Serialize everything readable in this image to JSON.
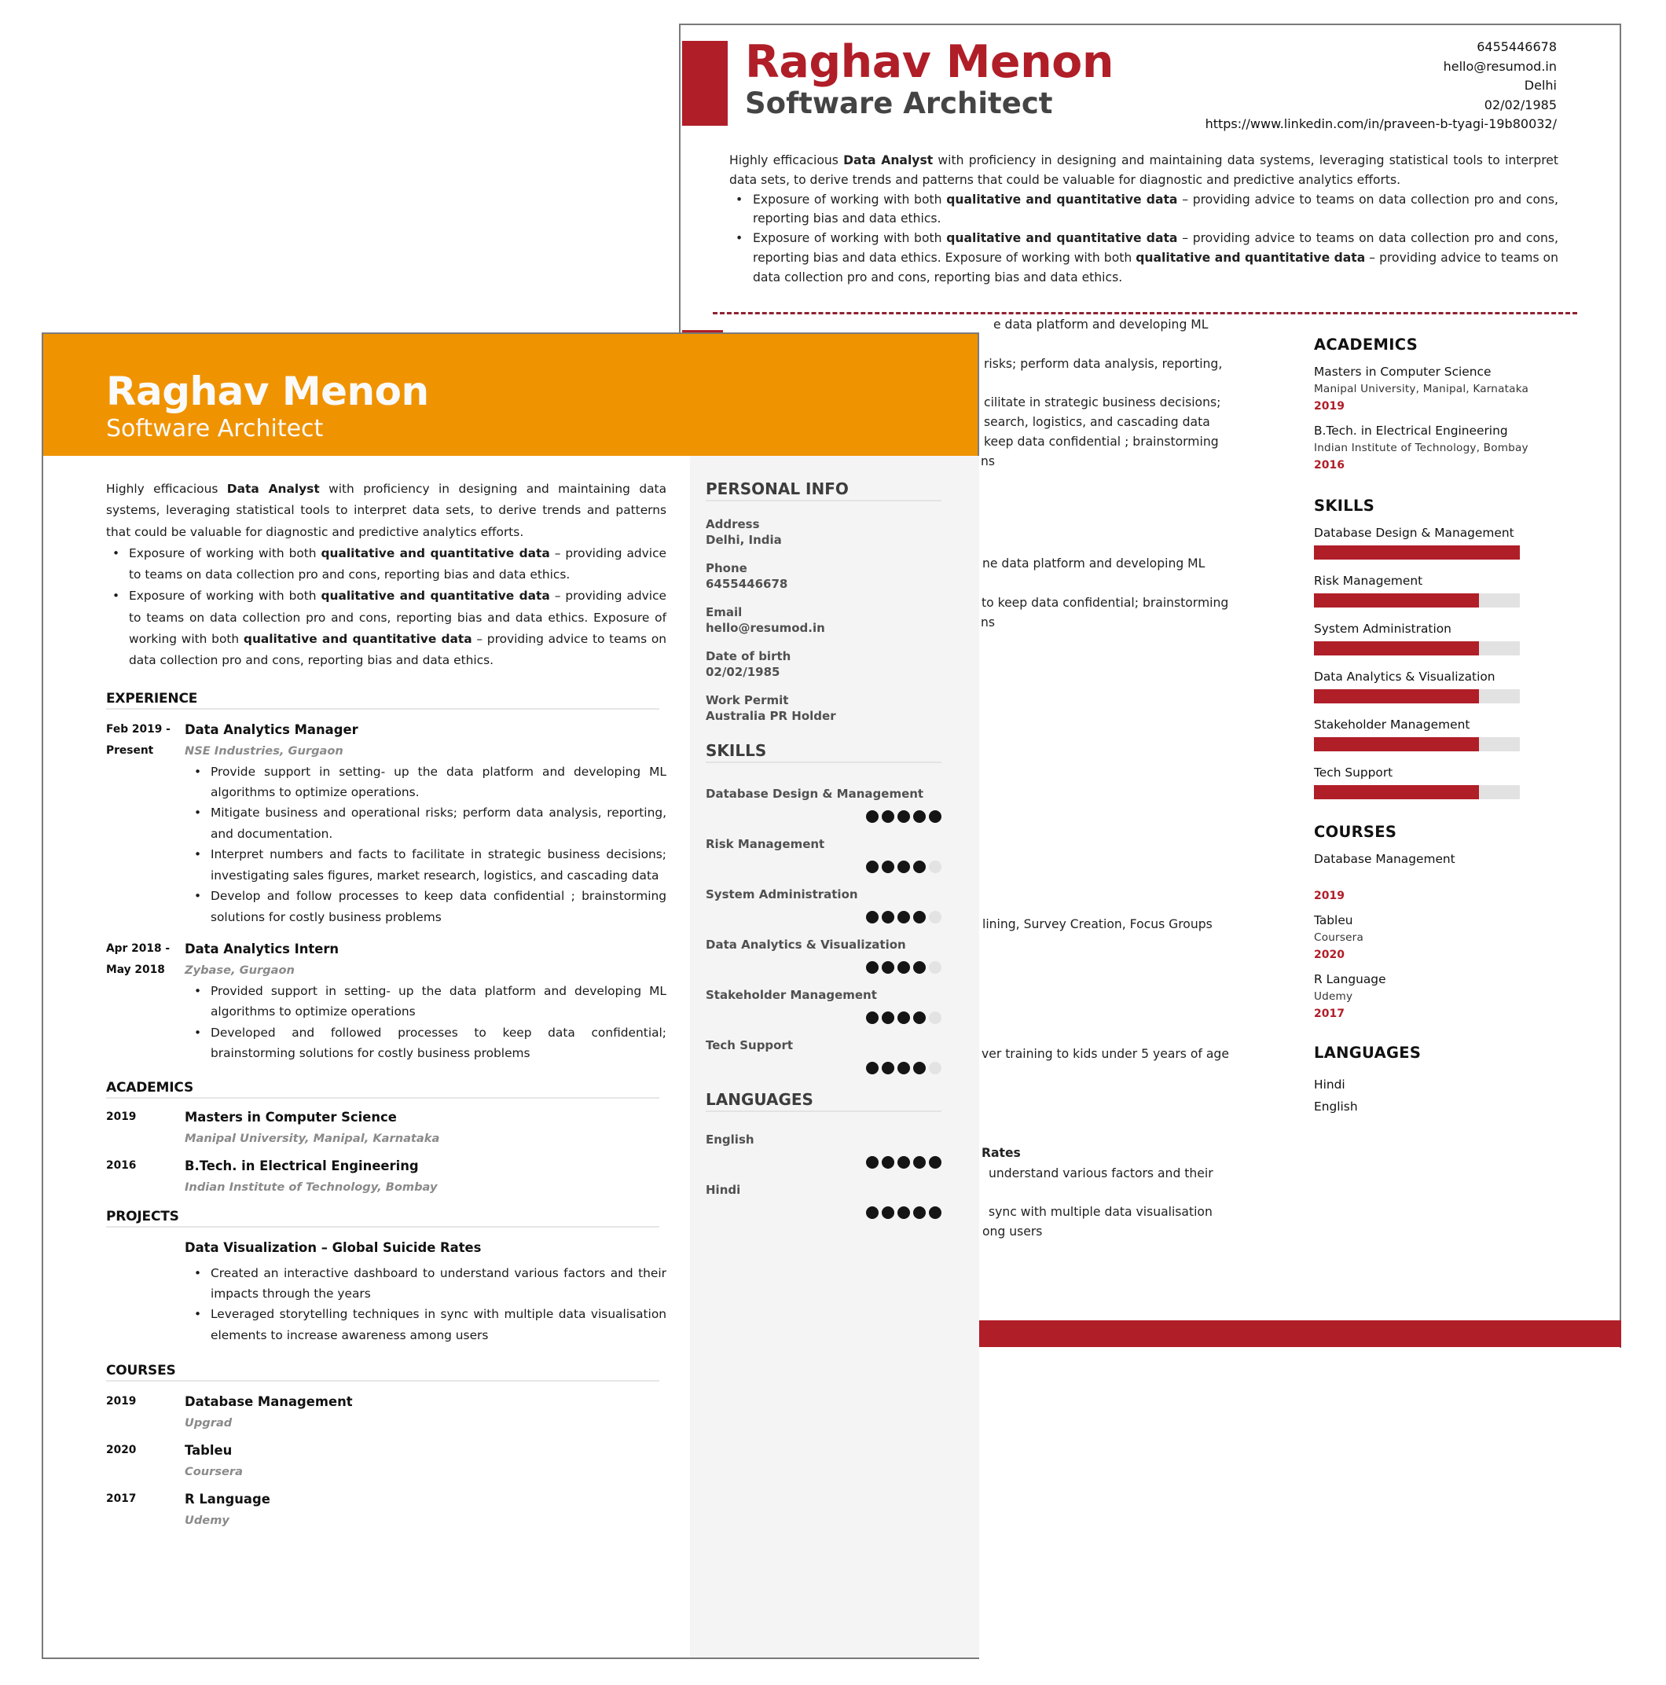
{
  "back_resume": {
    "name": "Raghav Menon",
    "title": "Software Architect",
    "accent_color": "#b01e28",
    "contacts": [
      "6455446678",
      "hello@resumod.in",
      "Delhi",
      "02/02/1985",
      "https://www.linkedin.com/in/praveen-b-tyagi-19b80032/"
    ],
    "summary": {
      "intro_pre": "Highly efficacious ",
      "intro_bold": "Data Analyst",
      "intro_post": " with proficiency in designing and maintaining data systems, leveraging statistical tools to interpret data sets, to derive trends and patterns that could be valuable for diagnostic and predictive analytics efforts.",
      "bullet_pre": "Exposure of working with both ",
      "bullet_bold": "qualitative and quantitative data",
      "bullet_post": " – providing advice to teams on data collection pro and cons, reporting bias and data ethics.",
      "bullet2_mid": " – providing advice to teams on data collection pro and cons, reporting bias and data ethics. Exposure of working with both "
    },
    "visible_fragments": [
      "e data platform and developing ML",
      "risks; perform data analysis, reporting,",
      "cilitate in strategic business decisions;",
      "search, logistics, and cascading data",
      "keep data confidential ; brainstorming",
      "ns",
      "ne data platform and developing ML",
      "to keep data confidential; brainstorming",
      "ns",
      "lining, Survey Creation, Focus Groups",
      "ver training to kids under 5 years of age",
      "Rates",
      "understand various factors and their",
      "sync with multiple data visualisation",
      "ong users"
    ],
    "academics": {
      "heading": "ACADEMICS",
      "items": [
        {
          "degree": "Masters in Computer Science",
          "institute": "Manipal University, Manipal, Karnataka",
          "year": "2019"
        },
        {
          "degree": "B.Tech. in Electrical Engineering",
          "institute": "Indian Institute of Technology, Bombay",
          "year": "2016"
        }
      ]
    },
    "skills": {
      "heading": "SKILLS",
      "items": [
        {
          "name": "Database Design & Management",
          "level": 1.0
        },
        {
          "name": "Risk Management",
          "level": 0.8
        },
        {
          "name": "System Administration",
          "level": 0.8
        },
        {
          "name": "Data Analytics & Visualization",
          "level": 0.8
        },
        {
          "name": "Stakeholder Management",
          "level": 0.8
        },
        {
          "name": "Tech Support",
          "level": 0.8
        }
      ]
    },
    "courses": {
      "heading": "COURSES",
      "items": [
        {
          "name": "Database Management",
          "provider": "",
          "year": "2019"
        },
        {
          "name": "Tableu",
          "provider": "Coursera",
          "year": "2020"
        },
        {
          "name": "R Language",
          "provider": "Udemy",
          "year": "2017"
        }
      ]
    },
    "languages": {
      "heading": "LANGUAGES",
      "items": [
        "Hindi",
        "English"
      ]
    }
  },
  "front_resume": {
    "name": "Raghav Menon",
    "title": "Software Architect",
    "header_color": "#f09300",
    "summary": {
      "intro_pre": "Highly efficacious ",
      "intro_bold": "Data Analyst",
      "intro_post": " with proficiency in designing and maintaining data systems, leveraging statistical tools to interpret data sets, to derive trends and patterns that could be valuable for diagnostic and predictive analytics efforts.",
      "bullet_pre": "Exposure of working with both ",
      "bullet_bold": "qualitative and quantitative data",
      "bullet_post": " – providing advice to teams on data collection pro and cons, reporting bias and data ethics.",
      "bullet2_mid": " – providing advice to teams on data collection pro and cons, reporting bias and data ethics. Exposure of working with both "
    },
    "experience": {
      "heading": "EXPERIENCE",
      "items": [
        {
          "date_start": "Feb 2019 -",
          "date_end": "Present",
          "role": "Data Analytics Manager",
          "company": "NSE Industries, Gurgaon",
          "bullets": [
            "Provide support in setting- up the data platform and developing ML algorithms to optimize operations.",
            "Mitigate business and operational risks; perform data analysis, reporting, and documentation.",
            "Interpret numbers and facts to facilitate in strategic business decisions; investigating sales figures, market research, logistics, and cascading data",
            "Develop and follow processes to keep data confidential ; brainstorming solutions for costly business problems"
          ]
        },
        {
          "date_start": "Apr 2018 -",
          "date_end": "May 2018",
          "role": "Data Analytics Intern",
          "company": "Zybase, Gurgaon",
          "bullets": [
            "Provided support in setting- up the data platform and developing ML algorithms to optimize operations",
            "Developed and followed processes to keep data confidential; brainstorming solutions for costly business problems"
          ]
        }
      ]
    },
    "academics": {
      "heading": "ACADEMICS",
      "items": [
        {
          "year": "2019",
          "degree": "Masters in Computer Science",
          "institute": "Manipal University, Manipal, Karnataka"
        },
        {
          "year": "2016",
          "degree": "B.Tech. in Electrical Engineering",
          "institute": "Indian Institute of Technology, Bombay"
        }
      ]
    },
    "projects": {
      "heading": "PROJECTS",
      "items": [
        {
          "title": "Data Visualization – Global Suicide Rates",
          "bullets": [
            "Created an interactive dashboard to understand various factors and their impacts through the years",
            "Leveraged storytelling techniques in sync with multiple data visualisation elements to increase awareness among users"
          ]
        }
      ]
    },
    "courses": {
      "heading": "COURSES",
      "items": [
        {
          "year": "2019",
          "name": "Database Management",
          "provider": "Upgrad"
        },
        {
          "year": "2020",
          "name": "Tableu",
          "provider": "Coursera"
        },
        {
          "year": "2017",
          "name": "R Language",
          "provider": "Udemy"
        }
      ]
    },
    "personal_info": {
      "heading": "PERSONAL INFO",
      "items": [
        {
          "label": "Address",
          "value": "Delhi, India"
        },
        {
          "label": "Phone",
          "value": "6455446678"
        },
        {
          "label": "Email",
          "value": "hello@resumod.in"
        },
        {
          "label": "Date of birth",
          "value": "02/02/1985"
        },
        {
          "label": "Work Permit",
          "value": "Australia PR Holder"
        }
      ]
    },
    "skills": {
      "heading": "SKILLS",
      "max_rating": 5,
      "items": [
        {
          "name": "Database Design & Management",
          "rating": 5
        },
        {
          "name": "Risk Management",
          "rating": 4
        },
        {
          "name": "System Administration",
          "rating": 4
        },
        {
          "name": "Data Analytics & Visualization",
          "rating": 4
        },
        {
          "name": "Stakeholder Management",
          "rating": 4
        },
        {
          "name": "Tech Support",
          "rating": 4
        }
      ]
    },
    "languages": {
      "heading": "LANGUAGES",
      "max_rating": 5,
      "items": [
        {
          "name": "English",
          "rating": 5
        },
        {
          "name": "Hindi",
          "rating": 5
        }
      ]
    }
  }
}
